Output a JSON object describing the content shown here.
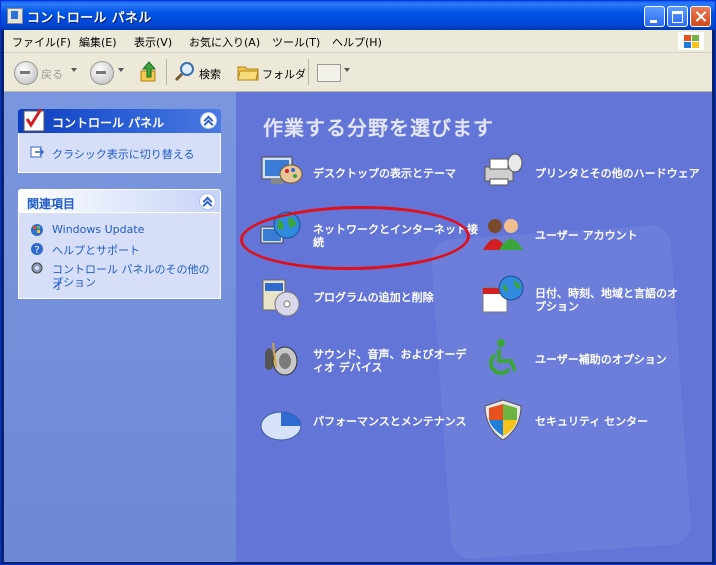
{
  "window": {
    "title": "コントロール パネル"
  },
  "menu": [
    "ファイル(F)",
    "編集(E)",
    "表示(V)",
    "お気に入り(A)",
    "ツール(T)",
    "ヘルプ(H)"
  ],
  "toolbar": {
    "back": "戻る",
    "search": "検索",
    "folders": "フォルダ"
  },
  "sidebar": {
    "control_panel": {
      "title": "コントロール パネル",
      "link": "クラシック表示に切り替える"
    },
    "related": {
      "title": "関連項目",
      "links": [
        "Windows Update",
        "ヘルプとサポート",
        "コントロール パネルのその他のオ",
        "プション"
      ]
    }
  },
  "main": {
    "heading": "作業する分野を選びます",
    "categories": [
      {
        "label1": "デスクトップの表示とテーマ",
        "label2": ""
      },
      {
        "label1": "プリンタとその他のハードウェア",
        "label2": ""
      },
      {
        "label1": "ネットワークとインターネット接",
        "label2": "続"
      },
      {
        "label1": "ユーザー アカウント",
        "label2": ""
      },
      {
        "label1": "プログラムの追加と削除",
        "label2": ""
      },
      {
        "label1": "日付、時刻、地域と言語のオ",
        "label2": "プション"
      },
      {
        "label1": "サウンド、音声、およびオーデ",
        "label2": "ィオ デバイス"
      },
      {
        "label1": "ユーザー補助のオプション",
        "label2": ""
      },
      {
        "label1": "パフォーマンスとメンテナンス",
        "label2": ""
      },
      {
        "label1": "セキュリティ センター",
        "label2": ""
      }
    ]
  },
  "colors": {
    "titlebar": "#0055e5",
    "main_bg": "#6375d6",
    "highlight_ellipse": "#e0101a"
  }
}
